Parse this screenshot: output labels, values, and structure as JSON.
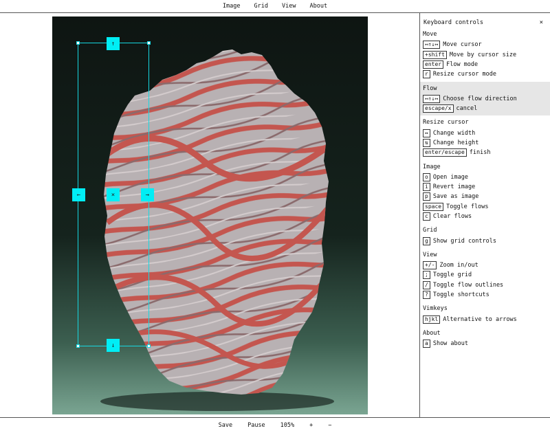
{
  "menubar": {
    "items": [
      "Image",
      "Grid",
      "View",
      "About"
    ]
  },
  "bottombar": {
    "save": "Save",
    "pause": "Pause",
    "zoom": "105%",
    "zoom_in": "+",
    "zoom_out": "−"
  },
  "cursor": {
    "handles": {
      "up": "↑",
      "down": "↓",
      "left": "←",
      "right": "→",
      "center": "×"
    },
    "color": "#00eef5"
  },
  "panel": {
    "title": "Keyboard controls",
    "close": "×",
    "sections": [
      {
        "title": "Move",
        "rows": [
          {
            "key": "↤↑↓↦",
            "label": "Move cursor"
          },
          {
            "key": "+shift",
            "label": "Move by cursor size"
          },
          {
            "key": "enter",
            "label": "Flow mode"
          },
          {
            "key": "r",
            "label": "Resize cursor mode"
          }
        ]
      },
      {
        "title": "Flow",
        "highlight": true,
        "rows": [
          {
            "key": "↤↑↓↦",
            "label": "Choose flow direction"
          },
          {
            "key": "escape/x",
            "label": "cancel"
          }
        ]
      },
      {
        "title": "Resize cursor",
        "rows": [
          {
            "key": "↔",
            "label": "Change width"
          },
          {
            "key": "⇅",
            "label": "Change height"
          },
          {
            "key": "enter/escape",
            "label": "finish"
          }
        ]
      },
      {
        "title": "Image",
        "rows": [
          {
            "key": "o",
            "label": "Open image"
          },
          {
            "key": "i",
            "label": "Revert image"
          },
          {
            "key": "p",
            "label": "Save as image"
          },
          {
            "key": "space",
            "label": "Toggle flows"
          },
          {
            "key": "c",
            "label": "Clear flows"
          }
        ]
      },
      {
        "title": "Grid",
        "rows": [
          {
            "key": "g",
            "label": "Show grid controls"
          }
        ]
      },
      {
        "title": "View",
        "rows": [
          {
            "key": "+/-",
            "label": "Zoom in/out"
          },
          {
            "key": ";",
            "label": "Toggle grid"
          },
          {
            "key": "/",
            "label": "Toggle flow outlines"
          },
          {
            "key": "?",
            "label": "Toggle shortcuts"
          }
        ]
      },
      {
        "title": "Vimkeys",
        "rows": [
          {
            "key": "hjkl",
            "label": "Alternative to arrows"
          }
        ]
      },
      {
        "title": "About",
        "rows": [
          {
            "key": "a",
            "label": "Show about"
          }
        ]
      }
    ]
  },
  "colors": {
    "accent": "#00eef5",
    "rock_red": "#c85a54",
    "rock_grey": "#b9b3b4",
    "bg_dark": "#13201b",
    "bg_green": "#6e9b87"
  }
}
